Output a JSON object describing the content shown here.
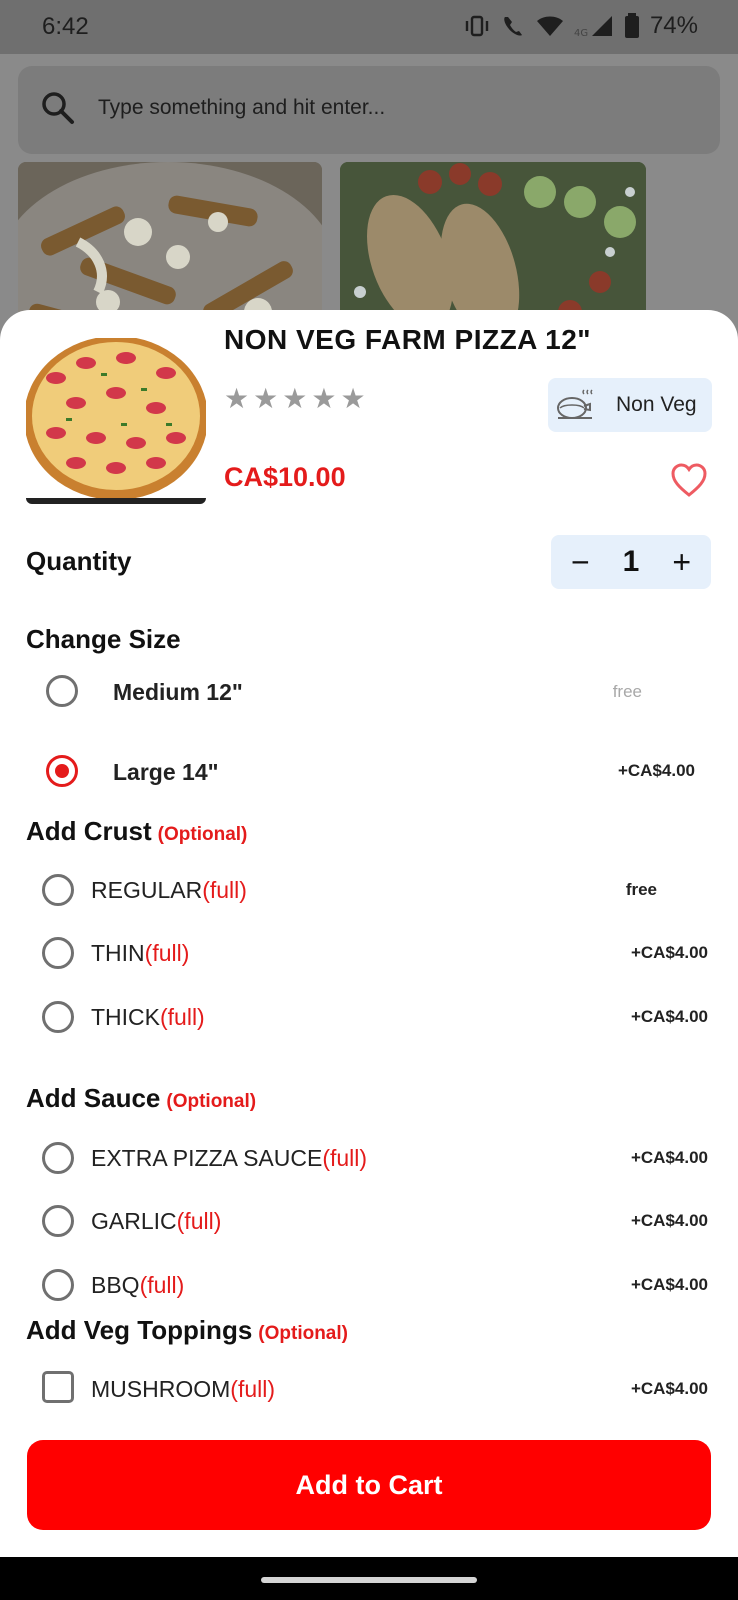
{
  "status_bar": {
    "time": "6:42",
    "battery": "74%",
    "network": "4G"
  },
  "search": {
    "placeholder": "Type something and hit enter..."
  },
  "product": {
    "name": "NON VEG FARM PIZZA 12\"",
    "rating": 0,
    "rating_max": 5,
    "type_badge": "Non Veg",
    "price": "CA$10.00"
  },
  "quantity": {
    "label": "Quantity",
    "value": "1"
  },
  "size": {
    "title": "Change Size",
    "options": [
      {
        "label": "Medium 12\"",
        "price": "free",
        "selected": false
      },
      {
        "label": "Large 14\"",
        "price": "+CA$4.00",
        "selected": true
      }
    ]
  },
  "crust": {
    "title": "Add Crust",
    "optional": "(Optional)",
    "options": [
      {
        "label": "REGULAR",
        "tag": "(full)",
        "price": "free"
      },
      {
        "label": "THIN",
        "tag": "(full)",
        "price": "+CA$4.00"
      },
      {
        "label": "THICK",
        "tag": "(full)",
        "price": "+CA$4.00"
      }
    ]
  },
  "sauce": {
    "title": "Add Sauce",
    "optional": "(Optional)",
    "options": [
      {
        "label": "EXTRA PIZZA SAUCE",
        "tag": "(full)",
        "price": "+CA$4.00"
      },
      {
        "label": "GARLIC",
        "tag": "(full)",
        "price": "+CA$4.00"
      },
      {
        "label": "BBQ",
        "tag": "(full)",
        "price": "+CA$4.00"
      }
    ]
  },
  "veg_toppings": {
    "title": "Add Veg Toppings",
    "optional": "(Optional)",
    "options": [
      {
        "label": "MUSHROOM",
        "tag": "(full)",
        "price": "+CA$4.00"
      }
    ]
  },
  "cta": {
    "label": "Add to Cart"
  },
  "colors": {
    "accent": "#e41b1b",
    "button": "#ff0000",
    "badge_bg": "#e6f0fb"
  }
}
